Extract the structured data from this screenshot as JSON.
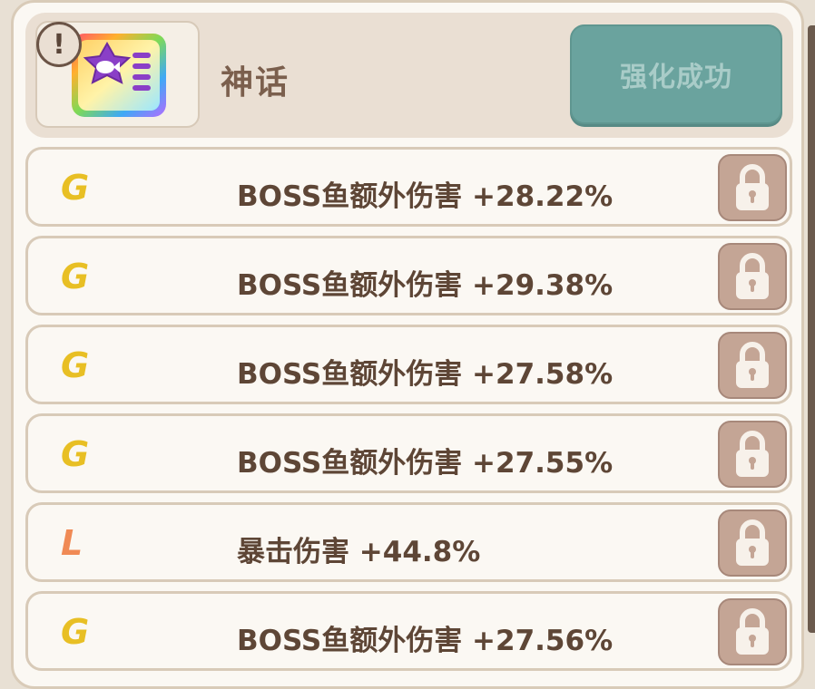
{
  "header": {
    "rarity": "神话",
    "enhance_button": "强化成功",
    "alert_symbol": "!"
  },
  "colors": {
    "grade_g": "#e8bf24",
    "grade_l": "#f08a55",
    "button_teal": "#6aa39e",
    "lock_bg": "#c4a595"
  },
  "stats": [
    {
      "grade": "G",
      "text": "BOSS鱼额外伤害 +28.22%",
      "color": "#e8bf24"
    },
    {
      "grade": "G",
      "text": "BOSS鱼额外伤害 +29.38%",
      "color": "#e8bf24"
    },
    {
      "grade": "G",
      "text": "BOSS鱼额外伤害 +27.58%",
      "color": "#e8bf24"
    },
    {
      "grade": "G",
      "text": "BOSS鱼额外伤害 +27.55%",
      "color": "#e8bf24"
    },
    {
      "grade": "L",
      "text": "暴击伤害 +44.8%",
      "color": "#f08a55"
    },
    {
      "grade": "G",
      "text": "BOSS鱼额外伤害 +27.56%",
      "color": "#e8bf24"
    }
  ]
}
